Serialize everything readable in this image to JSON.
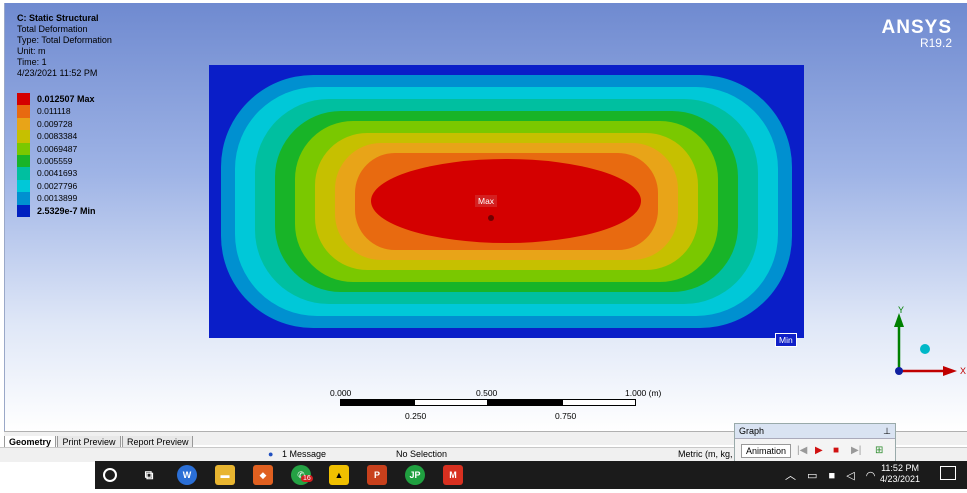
{
  "header": {
    "title": "C: Static Structural",
    "result": "Total Deformation",
    "type": "Type: Total Deformation",
    "unit": "Unit: m",
    "time": "Time: 1",
    "date": "4/23/2021 11:52 PM"
  },
  "legend": [
    {
      "label": "0.012507 Max",
      "color": "#d40000",
      "bold": true
    },
    {
      "label": "0.011118",
      "color": "#e86a10",
      "bold": false
    },
    {
      "label": "0.009728",
      "color": "#e8a418",
      "bold": false
    },
    {
      "label": "0.0083384",
      "color": "#c6c000",
      "bold": false
    },
    {
      "label": "0.0069487",
      "color": "#7ac800",
      "bold": false
    },
    {
      "label": "0.005559",
      "color": "#18b428",
      "bold": false
    },
    {
      "label": "0.0041693",
      "color": "#00bfa0",
      "bold": false
    },
    {
      "label": "0.0027796",
      "color": "#00c8d8",
      "bold": false
    },
    {
      "label": "0.0013899",
      "color": "#0090d0",
      "bold": false
    },
    {
      "label": "2.5329e-7 Min",
      "color": "#0020c0",
      "bold": true
    }
  ],
  "logo": {
    "name": "ANSYS",
    "version": "R19.2"
  },
  "probes": {
    "max_label": "Max",
    "min_label": "Min"
  },
  "scale": {
    "top_labels": [
      "0.000",
      "0.500",
      "1.000 (m)"
    ],
    "bottom_labels": [
      "0.250",
      "0.750"
    ]
  },
  "triad": {
    "x_label": "X",
    "y_label": "Y",
    "x_color": "#c00000",
    "y_color": "#008000"
  },
  "tabs": [
    {
      "label": "Geometry",
      "active": true
    },
    {
      "label": "Print Preview",
      "active": false
    },
    {
      "label": "Report Preview",
      "active": false
    }
  ],
  "status": {
    "messages": "1 Message",
    "selection": "No Selection",
    "units": "Metric (m, kg,"
  },
  "graph": {
    "title": "Graph",
    "pin": "⊥",
    "animation_label": "Animation"
  },
  "taskbar": {
    "time": "11:52 PM",
    "date": "4/23/2021",
    "badge": "16"
  }
}
